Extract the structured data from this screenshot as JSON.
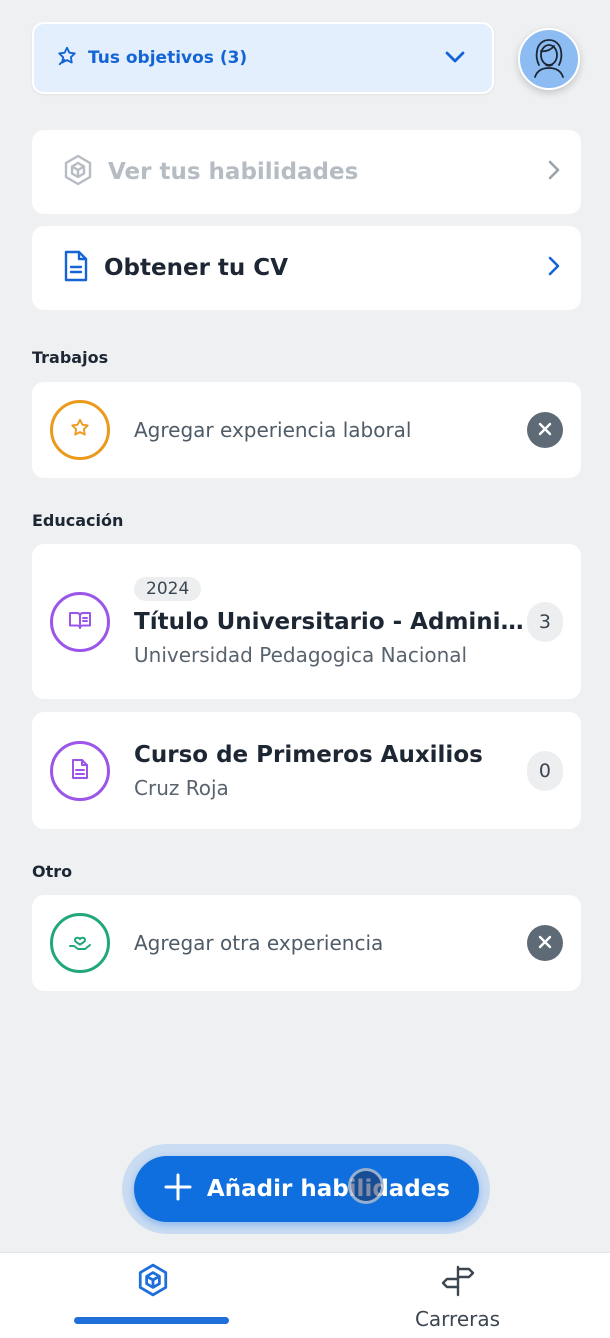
{
  "goals": {
    "label": "Tus objetivos (3)",
    "icon": "goal-star-icon"
  },
  "avatar": {
    "icon": "user-avatar-icon"
  },
  "nav_cards": {
    "skills": {
      "label": "Ver tus habilidades",
      "state": "disabled"
    },
    "cv": {
      "label": "Obtener tu CV"
    }
  },
  "sections": {
    "jobs": {
      "title": "Trabajos",
      "placeholder": "Agregar experiencia laboral"
    },
    "education": {
      "title": "Educación",
      "items": [
        {
          "year": "2024",
          "title": "Título Universitario - Administr…",
          "subtitle": "Universidad Pedagogica Nacional",
          "count": "3"
        },
        {
          "title": "Curso de Primeros Auxilios",
          "subtitle": "Cruz Roja",
          "count": "0"
        }
      ]
    },
    "other": {
      "title": "Otro",
      "placeholder": "Agregar otra experiencia"
    }
  },
  "fab": {
    "label": "Añadir habilidades"
  },
  "bottom_nav": {
    "tabs": [
      {
        "id": "skills",
        "label": "",
        "icon": "skills-hexagon-icon",
        "active": true
      },
      {
        "id": "careers",
        "label": "Carreras",
        "icon": "signpost-icon",
        "active": false
      }
    ]
  },
  "colors": {
    "accent": "#0f6fde",
    "jobs_ring": "#eb9a1c",
    "education_ring": "#9b55e8",
    "other_ring": "#22a77d"
  }
}
